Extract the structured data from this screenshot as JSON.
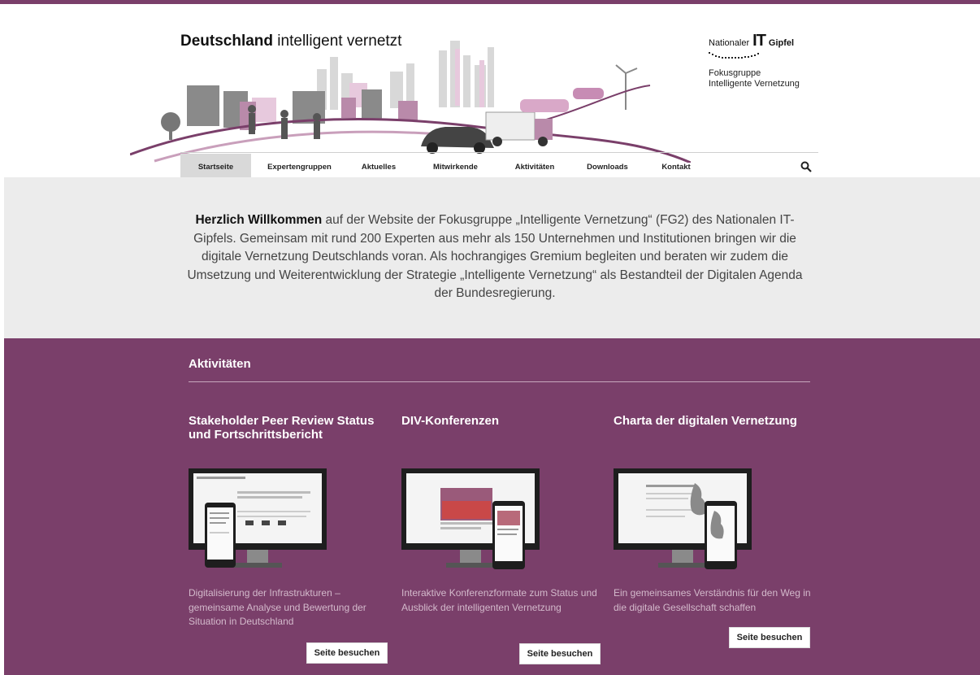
{
  "header": {
    "title_bold": "Deutschland",
    "title_rest": " intelligent vernetzt",
    "logo": {
      "prefix": "Nationaler",
      "big": "IT",
      "suffix": "Gipfel",
      "sub_line1": "Fokusgruppe",
      "sub_line2": "Intelligente Vernetzung"
    }
  },
  "nav": {
    "items": [
      {
        "label": "Startseite",
        "active": true
      },
      {
        "label": "Expertengruppen"
      },
      {
        "label": "Aktuelles"
      },
      {
        "label": "Mitwirkende"
      },
      {
        "label": "Aktivitäten"
      },
      {
        "label": "Downloads"
      },
      {
        "label": "Kontakt"
      }
    ],
    "search_icon": "search-icon"
  },
  "intro": {
    "bold": "Herzlich Willkommen",
    "text": " auf der Website der Fokusgruppe „Intelligente Vernetzung“ (FG2) des Nationalen IT-Gipfels. Gemeinsam mit rund 200 Experten aus mehr als 150 Unternehmen und Institutionen bringen wir die digitale Vernetzung Deutschlands voran. Als hochrangiges Gremium begleiten und beraten wir zudem die Umsetzung und Weiterentwicklung der Strategie „Intelligente Vernetzung“ als Bestandteil der Digitalen Agenda der Bundesregierung."
  },
  "activities": {
    "title": "Aktivitäten",
    "cards": [
      {
        "title": "Stakeholder Peer Review Status und Fortschrittsbericht",
        "desc": "Digitalisierung der Infrastrukturen – gemeinsame Analyse und Bewertung der Situation in Deutschland",
        "button": "Seite besuchen"
      },
      {
        "title": "DIV-Konferenzen",
        "desc": "Interaktive Konferenzformate zum Status und Ausblick der intelligenten Vernetzung",
        "button": "Seite besuchen"
      },
      {
        "title": "Charta der digitalen Vernetzung",
        "desc": "Ein gemeinsames Verständnis für den Weg in die digitale Gesellschaft schaffen",
        "button": "Seite besuchen"
      }
    ]
  },
  "colors": {
    "brand_purple": "#7a3f6a",
    "intro_bg": "#ececec",
    "nav_active_bg": "#d9d9d9",
    "card_desc": "#d3b9cb"
  }
}
